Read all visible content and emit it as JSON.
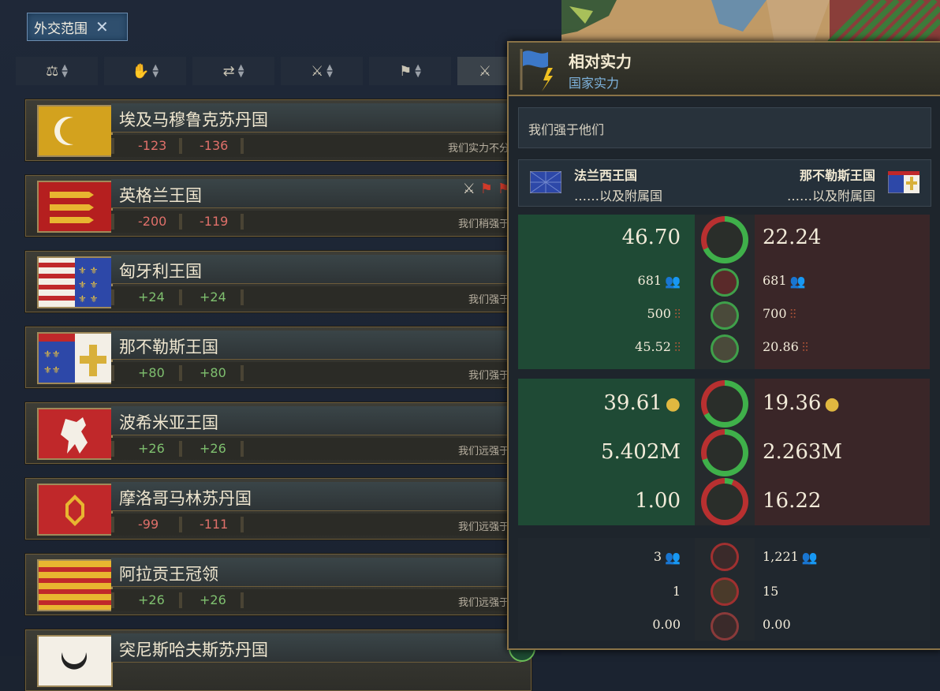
{
  "tab": {
    "label": "外交范围",
    "close": "✕"
  },
  "filters": [
    {
      "icon": "scales-icon"
    },
    {
      "icon": "handshake-icon"
    },
    {
      "icon": "trade-icon"
    },
    {
      "icon": "crossed-swords-icon"
    },
    {
      "icon": "flags-icon"
    },
    {
      "icon": "sword-icon"
    }
  ],
  "countries": [
    {
      "name": "埃及马穆鲁克苏丹国",
      "v1": "-123",
      "v2": "-136",
      "status": "我们实力不分伯",
      "flag": "egypt"
    },
    {
      "name": "英格兰王国",
      "v1": "-200",
      "v2": "-119",
      "status": "我们稍强于他",
      "flag": "england"
    },
    {
      "name": "匈牙利王国",
      "v1": "+24",
      "v2": "+24",
      "status": "我们强于他",
      "flag": "hungary"
    },
    {
      "name": "那不勒斯王国",
      "v1": "+80",
      "v2": "+80",
      "status": "我们强于他",
      "flag": "naples"
    },
    {
      "name": "波希米亚王国",
      "v1": "+26",
      "v2": "+26",
      "status": "我们远强于他",
      "flag": "bohemia"
    },
    {
      "name": "摩洛哥马林苏丹国",
      "v1": "-99",
      "v2": "-111",
      "status": "我们远强于他",
      "flag": "morocco"
    },
    {
      "name": "阿拉贡王冠领",
      "v1": "+26",
      "v2": "+26",
      "status": "我们远强于他",
      "flag": "aragon"
    },
    {
      "name": "突尼斯哈夫斯苏丹国",
      "v1": "",
      "v2": "",
      "status": "",
      "flag": "tunis"
    }
  ],
  "panel": {
    "title": "相对实力",
    "subtitle": "国家实力",
    "verdict": "我们强于他们",
    "left_country": "法兰西王国",
    "left_sub": "……以及附属国",
    "right_country": "那不勒斯王国",
    "right_sub": "……以及附属国",
    "military": {
      "total": {
        "left": "46.70",
        "right": "22.24",
        "left_share": 0.68
      },
      "rows": [
        {
          "left": "681",
          "right": "681",
          "icon": "soldiers-icon",
          "center": "helmet-icon"
        },
        {
          "left": "500",
          "right": "700",
          "icon": "regiments-icon",
          "center": "shield-icon"
        },
        {
          "left": "45.52",
          "right": "20.86",
          "icon": "regiments-icon",
          "center": "swords-icon"
        }
      ]
    },
    "economy": [
      {
        "left": "39.61",
        "right": "19.36",
        "icon": "coins-icon",
        "left_share": 0.67
      },
      {
        "left": "5.402M",
        "right": "2.263M",
        "icon": "population-icon",
        "left_share": 0.7
      },
      {
        "left": "1.00",
        "right": "16.22",
        "icon": "navy-wheel-icon",
        "left_share": 0.06
      }
    ],
    "misc": [
      {
        "left": "3",
        "right": "1,221",
        "icon": "people-icon"
      },
      {
        "left": "1",
        "right": "15",
        "icon": "crest-icon"
      },
      {
        "left": "0.00",
        "right": "0.00",
        "icon": "medal-icon"
      }
    ]
  },
  "colors": {
    "positive": "#7fc06f",
    "negative": "#e0706a",
    "accent_blue": "#7fb4de",
    "gold_border": "#8a7347"
  }
}
